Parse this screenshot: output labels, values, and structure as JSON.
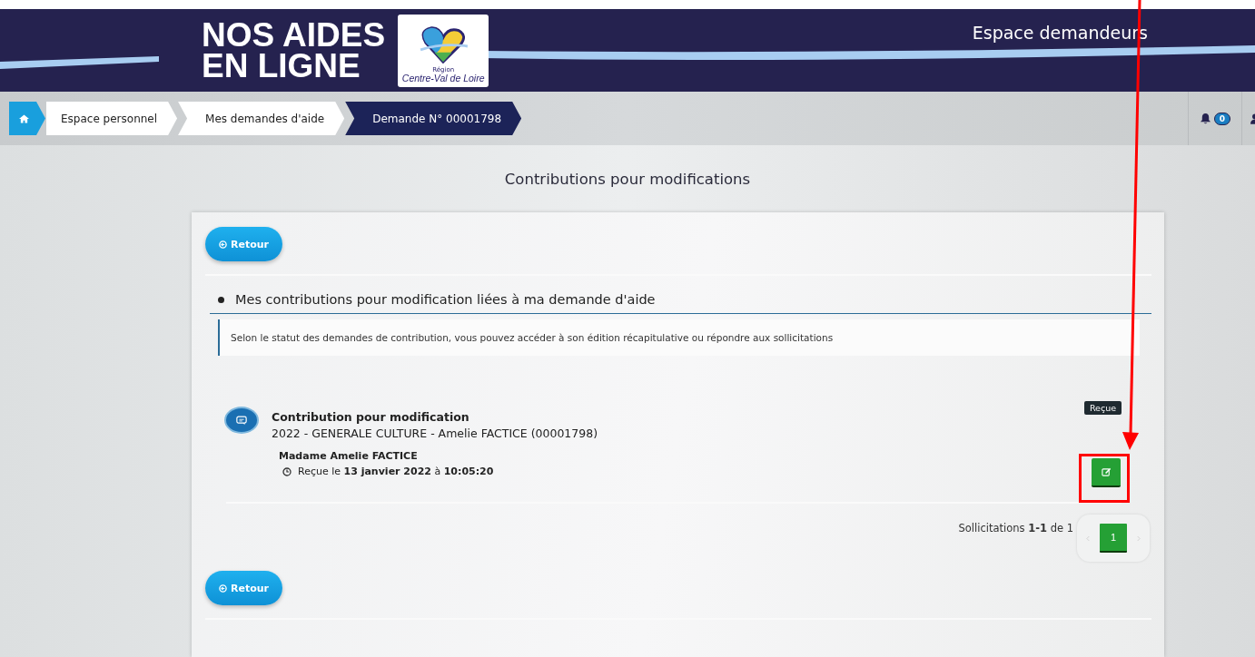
{
  "header": {
    "title_lines": [
      "NOS AIDES",
      "EN LIGNE"
    ],
    "region_small": "Région",
    "region_name": "Centre-Val de Loire",
    "space_label": "Espace demandeurs"
  },
  "breadcrumb": [
    {
      "kind": "home",
      "selected": false
    },
    {
      "kind": "link",
      "label": "Espace personnel",
      "selected": false
    },
    {
      "kind": "link",
      "label": "Mes demandes d'aide",
      "selected": false
    },
    {
      "kind": "link",
      "label": "Demande N° 00001798",
      "selected": true
    }
  ],
  "notifications": {
    "count": "0"
  },
  "page_title": "Contributions pour modifications",
  "back_buttons": [
    "Retour",
    "Retour"
  ],
  "section": {
    "title": "Mes contributions pour modification liées à ma demande d'aide",
    "info": "Selon le statut des demandes de contribution, vous pouvez accéder à son édition récapitulative ou répondre aux sollicitations"
  },
  "contributions": [
    {
      "title": "Contribution pour modification",
      "subtitle": "2022 - GENERALE CULTURE - Amelie FACTICE (00001798)",
      "person": "Madame Amelie FACTICE",
      "received": "Reçue le **13 janvier 2022** à **10:05:20**",
      "status": "Reçue"
    }
  ],
  "pagination": {
    "summary": "Sollicitations **1-1** de 1",
    "pages": [
      {
        "label": "1",
        "selected": true
      }
    ]
  }
}
